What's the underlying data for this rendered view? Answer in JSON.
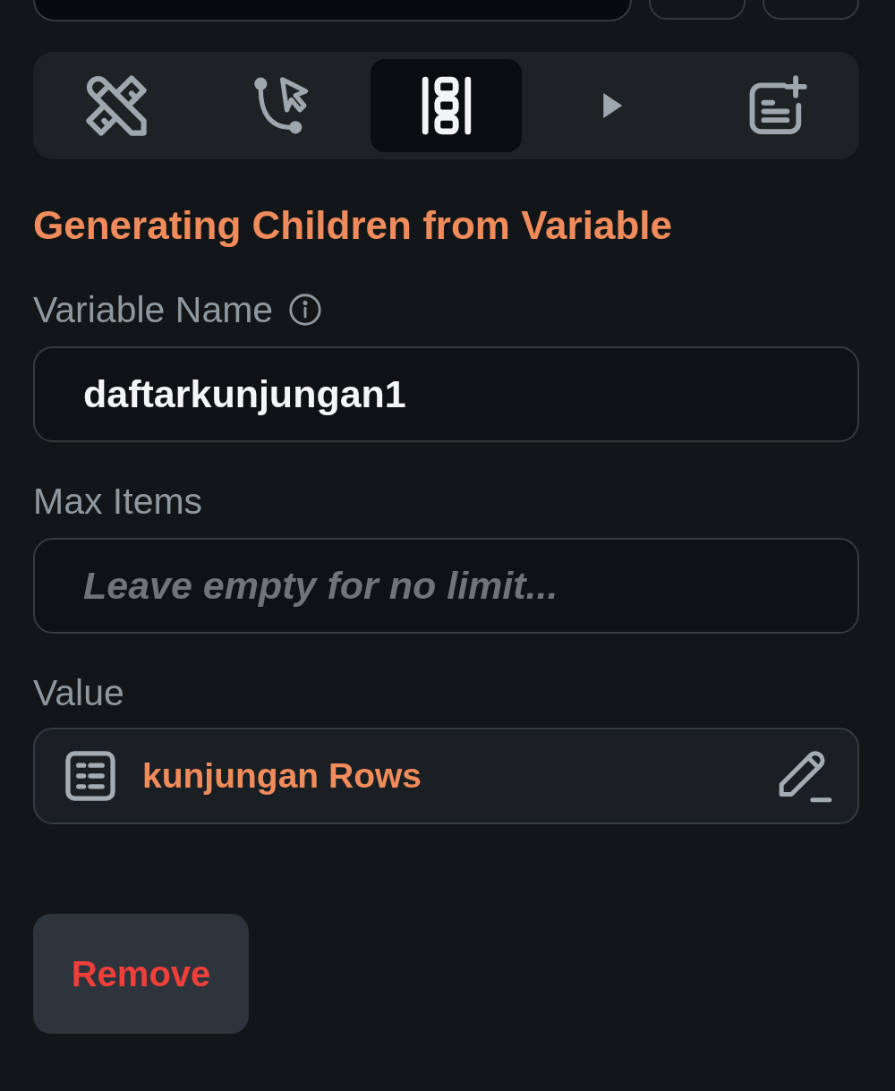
{
  "top_bar": [
    {
      "kind": "field"
    },
    {
      "kind": "button"
    },
    {
      "kind": "button"
    }
  ],
  "tabs": [
    {
      "selected": false
    },
    {
      "selected": false
    },
    {
      "selected": true
    },
    {
      "selected": false
    },
    {
      "selected": false
    }
  ],
  "section": {
    "title": "Generating Children from Variable",
    "fields": [
      {
        "kind": "input",
        "label": "Variable Name",
        "info": true,
        "value": "daftarkunjungan1"
      },
      {
        "kind": "input",
        "label": "Max Items",
        "info": false,
        "placeholder": "Leave empty for no limit..."
      },
      {
        "kind": "binding",
        "label": "Value",
        "info": false,
        "value": "kunjungan Rows"
      }
    ]
  },
  "buttons": [
    {
      "kind": "danger",
      "label": "Remove"
    }
  ]
}
